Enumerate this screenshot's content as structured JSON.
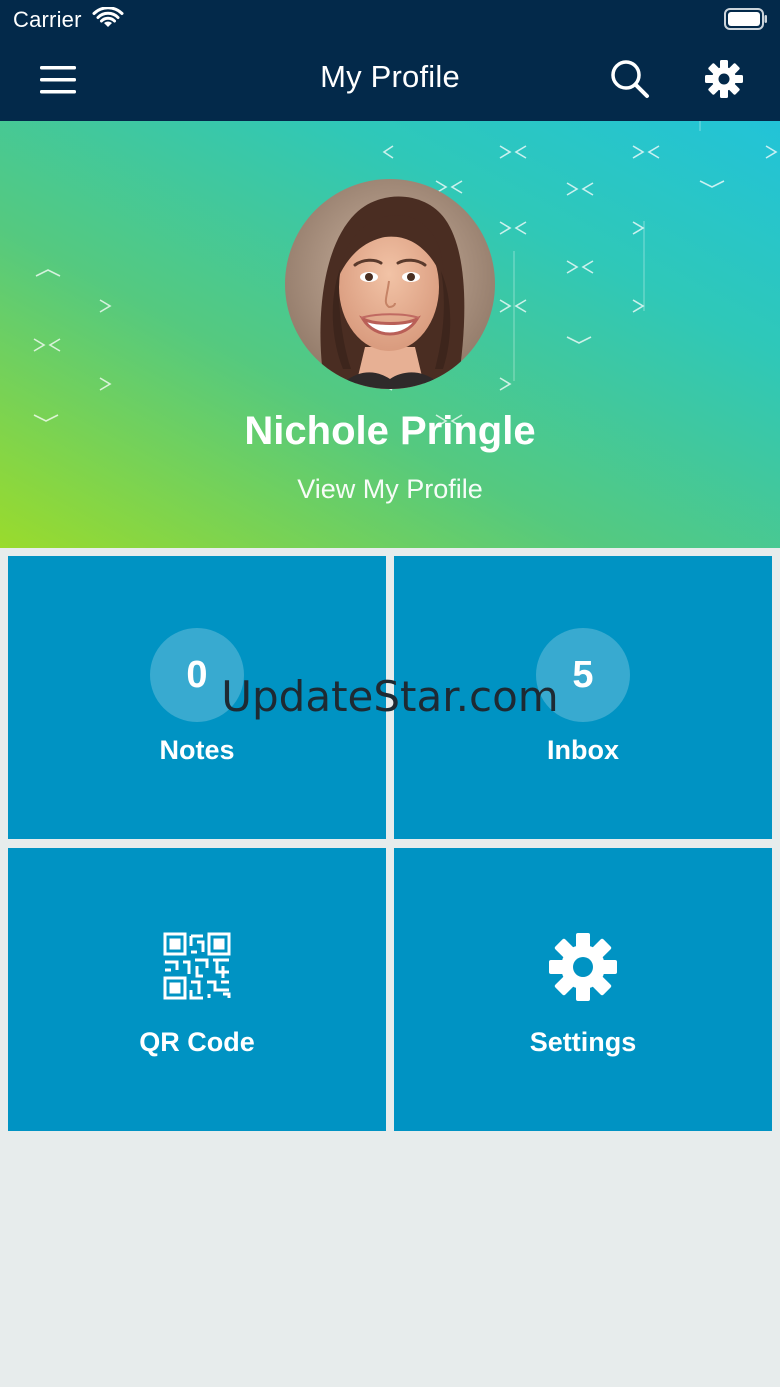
{
  "status_bar": {
    "carrier": "Carrier"
  },
  "nav": {
    "title": "My Profile",
    "icons": [
      "hamburger-menu-icon",
      "search-icon",
      "gear-icon"
    ]
  },
  "profile": {
    "name": "Nichole Pringle",
    "link_label": "View My Profile"
  },
  "tiles": [
    {
      "label": "Notes",
      "count": "0"
    },
    {
      "label": "Inbox",
      "count": "5"
    },
    {
      "label": "QR Code",
      "icon": "qr-code-icon"
    },
    {
      "label": "Settings",
      "icon": "gear-icon"
    }
  ],
  "watermark": "UpdateStar.com",
  "colors": {
    "nav_bg": "#03294a",
    "tile_bg": "#0093c3",
    "page_bg": "#e7ecec",
    "hero_gradient": [
      "#9adb2c",
      "#55c97f",
      "#2fc8b8",
      "#22c3d8"
    ]
  }
}
